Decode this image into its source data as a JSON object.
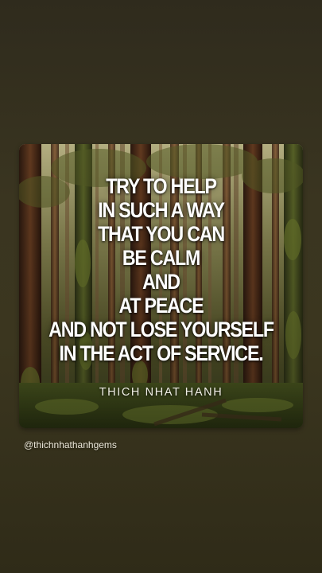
{
  "quote": {
    "lines": [
      "TRY TO HELP",
      "IN SUCH A WAY",
      "THAT YOU CAN",
      "BE CALM",
      "AND",
      "AT PEACE",
      "AND NOT LOSE YOURSELF",
      "IN THE ACT OF SERVICE."
    ],
    "author": "THICH NHAT HANH"
  },
  "mention": "@thichnhathanhgems",
  "colors": {
    "background_top": "#2f2b1d",
    "background_bottom": "#2f2b18",
    "quote_text": "#ffffff"
  }
}
